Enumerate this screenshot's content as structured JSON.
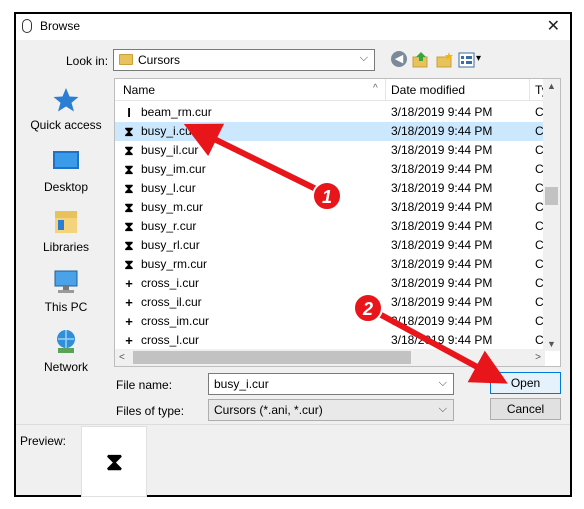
{
  "window": {
    "title": "Browse",
    "close_glyph": "✕"
  },
  "look_in": {
    "label": "Look in:",
    "value": "Cursors",
    "arrow": "⌵"
  },
  "toolbar": {
    "back_glyph": "◀",
    "view_glyph": "▾"
  },
  "places": [
    {
      "label": "Quick access",
      "icon": "star-icon"
    },
    {
      "label": "Desktop",
      "icon": "desktop-icon"
    },
    {
      "label": "Libraries",
      "icon": "libraries-icon"
    },
    {
      "label": "This PC",
      "icon": "computer-icon"
    },
    {
      "label": "Network",
      "icon": "network-icon"
    }
  ],
  "columns": {
    "name": "Name",
    "date": "Date modified",
    "type": "Ty",
    "sort_glyph": "^"
  },
  "files": [
    {
      "name": "beam_rm.cur",
      "date": "3/18/2019 9:44 PM",
      "type": "Cu",
      "glyph": "I"
    },
    {
      "name": "busy_i.cur",
      "date": "3/18/2019 9:44 PM",
      "type": "Cu",
      "glyph": "⧗"
    },
    {
      "name": "busy_il.cur",
      "date": "3/18/2019 9:44 PM",
      "type": "Cu",
      "glyph": "⧗"
    },
    {
      "name": "busy_im.cur",
      "date": "3/18/2019 9:44 PM",
      "type": "Cu",
      "glyph": "⧗"
    },
    {
      "name": "busy_l.cur",
      "date": "3/18/2019 9:44 PM",
      "type": "Cu",
      "glyph": "⧗"
    },
    {
      "name": "busy_m.cur",
      "date": "3/18/2019 9:44 PM",
      "type": "Cu",
      "glyph": "⧗"
    },
    {
      "name": "busy_r.cur",
      "date": "3/18/2019 9:44 PM",
      "type": "Cu",
      "glyph": "⧗"
    },
    {
      "name": "busy_rl.cur",
      "date": "3/18/2019 9:44 PM",
      "type": "Cu",
      "glyph": "⧗"
    },
    {
      "name": "busy_rm.cur",
      "date": "3/18/2019 9:44 PM",
      "type": "Cu",
      "glyph": "⧗"
    },
    {
      "name": "cross_i.cur",
      "date": "3/18/2019 9:44 PM",
      "type": "Cu",
      "glyph": "+"
    },
    {
      "name": "cross_il.cur",
      "date": "3/18/2019 9:44 PM",
      "type": "Cu",
      "glyph": "+"
    },
    {
      "name": "cross_im.cur",
      "date": "3/18/2019 9:44 PM",
      "type": "Cu",
      "glyph": "+"
    },
    {
      "name": "cross_l.cur",
      "date": "3/18/2019 9:44 PM",
      "type": "Cu",
      "glyph": "+"
    }
  ],
  "selected_file": "busy_i.cur",
  "file_name": {
    "label": "File name:",
    "value": "busy_i.cur"
  },
  "file_type": {
    "label": "Files of type:",
    "value": "Cursors (*.ani, *.cur)"
  },
  "buttons": {
    "open": "Open",
    "cancel": "Cancel"
  },
  "preview": {
    "label": "Preview:",
    "glyph": "⧗"
  },
  "annotations": [
    {
      "number": "1",
      "color": "#e8151b"
    },
    {
      "number": "2",
      "color": "#e8151b"
    }
  ],
  "colors": {
    "selection": "#cce8ff",
    "accent": "#0078d7",
    "annotation": "#e8151b"
  }
}
